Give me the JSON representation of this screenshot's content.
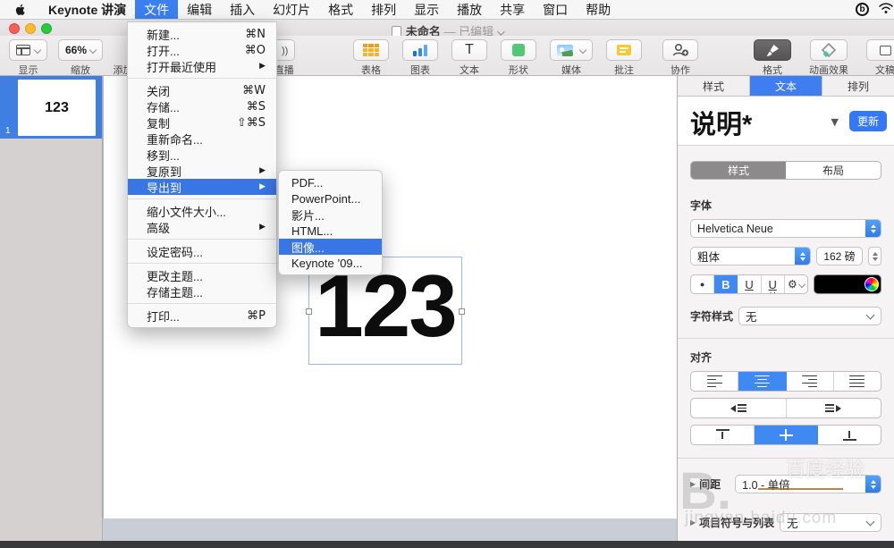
{
  "chrome": {
    "app_menu_items": [
      {
        "label": "Keynote 讲演",
        "bold": true
      },
      {
        "label": "文件",
        "selected": true
      },
      {
        "label": "编辑"
      },
      {
        "label": "插入"
      },
      {
        "label": "幻灯片"
      },
      {
        "label": "格式"
      },
      {
        "label": "排列"
      },
      {
        "label": "显示"
      },
      {
        "label": "播放"
      },
      {
        "label": "共享"
      },
      {
        "label": "窗口"
      },
      {
        "label": "帮助"
      }
    ],
    "doc_title": "未命名",
    "doc_status": "— 已编辑"
  },
  "toolbar": {
    "view_label": "显示",
    "zoom_value": "66%",
    "zoom_label": "缩放",
    "add_slide_partial": "添加幻",
    "live_partial": "e 直播",
    "insert_buttons": [
      {
        "label": "表格"
      },
      {
        "label": "图表"
      },
      {
        "label": "文本"
      },
      {
        "label": "形状"
      },
      {
        "label": "媒体"
      },
      {
        "label": "批注"
      }
    ],
    "collab_label": "协作",
    "right_buttons": [
      {
        "label": "格式",
        "selected": true
      },
      {
        "label": "动画效果"
      },
      {
        "label": "文稿"
      }
    ]
  },
  "file_menu": {
    "items": [
      {
        "label": "新建...",
        "shortcut": "⌘N"
      },
      {
        "label": "打开...",
        "shortcut": "⌘O"
      },
      {
        "label": "打开最近使用",
        "arrow": true
      },
      {
        "type": "sep"
      },
      {
        "label": "关闭",
        "shortcut": "⌘W"
      },
      {
        "label": "存储...",
        "shortcut": "⌘S"
      },
      {
        "label": "复制",
        "shortcut": "⇧⌘S"
      },
      {
        "label": "重新命名..."
      },
      {
        "label": "移到..."
      },
      {
        "label": "复原到",
        "arrow": true
      },
      {
        "label": "导出到",
        "arrow": true,
        "selected": true
      },
      {
        "type": "sep"
      },
      {
        "label": "缩小文件大小..."
      },
      {
        "label": "高级",
        "arrow": true
      },
      {
        "type": "sep"
      },
      {
        "label": "设定密码..."
      },
      {
        "type": "sep"
      },
      {
        "label": "更改主题..."
      },
      {
        "label": "存储主题..."
      },
      {
        "type": "sep"
      },
      {
        "label": "打印...",
        "shortcut": "⌘P"
      }
    ]
  },
  "export_submenu": {
    "items": [
      {
        "label": "PDF..."
      },
      {
        "label": "PowerPoint..."
      },
      {
        "label": "影片..."
      },
      {
        "label": "HTML..."
      },
      {
        "label": "图像...",
        "selected": true
      },
      {
        "label": "Keynote ’09..."
      }
    ]
  },
  "sidebar": {
    "slide_number": "1",
    "thumb_text": "123"
  },
  "canvas": {
    "slide_text": "123"
  },
  "inspector": {
    "tabs": [
      {
        "label": "样式"
      },
      {
        "label": "文本",
        "selected": true
      },
      {
        "label": "排列"
      }
    ],
    "style_name": "说明*",
    "update_label": "更新",
    "mode_tabs": [
      {
        "label": "样式",
        "selected": true
      },
      {
        "label": "布局"
      }
    ],
    "font_section_label": "字体",
    "font_family": "Helvetica Neue",
    "font_weight": "粗体",
    "font_size": "162 磅",
    "bold_label": "B",
    "underline_label": "U",
    "char_style_label": "字符样式",
    "char_style_value": "无",
    "align_label": "对齐",
    "spacing_label": "间距",
    "spacing_value": "1.0 - 单倍",
    "bullets_label": "项目符号与列表",
    "bullets_value": "无"
  },
  "watermark": {
    "logo": "B.",
    "cn": "百度经验",
    "url": "jingyan.baidu.com"
  },
  "colors": {
    "menu_highlight": "#3875e5",
    "accent_blue": "#3f7ef0",
    "selected_thumb": "#3e7fe1"
  }
}
